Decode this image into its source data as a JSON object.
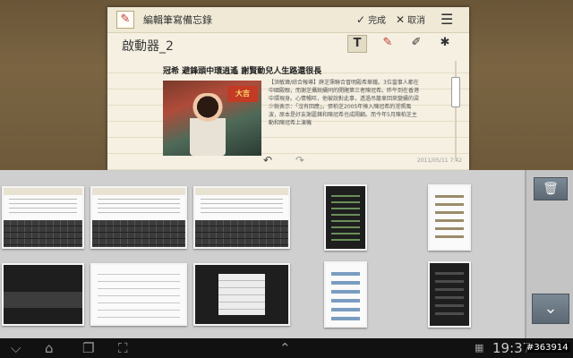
{
  "memo": {
    "title": "編輯筆寫備忘錄",
    "done_label": "完成",
    "done_icon": "checkmark-icon",
    "cancel_label": "取消",
    "cancel_icon": "close-icon",
    "menu_icon": "overflow-menu-icon",
    "subject": "啟動器_2",
    "tools": [
      "text-tool-icon",
      "pen-tool-icon",
      "eraser-tool-icon",
      "palette-icon"
    ],
    "clip_headline": "冠希 避鋒頭中環逍遙 謝賢動兒人生路還很長",
    "clip_text": "【洪敏瑋/綜合報導】薛芝霈聯合冒明殿希華鐵。3位當事人都在中國殿眼，而謝芝攝鋭續同的開賭第三者陳冠希。昨午到在香港中環現身。心情暢旺，他被說對此事，透過吊籠車回來變續的梁少鋭表示：「沒有回應」。張柏芝2005年捧入陳冠希的淫照風波，原本是好友謝霆鋒和陳冠希也成鬧翻。而今年5月陳柏芝主動和陳冠希上演機",
    "photo_sign": "大吉",
    "date": "2011/05/11 7:42"
  },
  "recent": {
    "delete_icon": "trash-icon",
    "scroll_down_icon": "chevron-down-icon"
  },
  "sysbar": {
    "time": "19:37",
    "back_icon": "back-icon",
    "home_icon": "home-icon",
    "recent_icon": "recent-apps-icon",
    "screenshot_icon": "screenshot-icon",
    "up_icon": "chevron-up-icon"
  },
  "watermark": "#363914"
}
